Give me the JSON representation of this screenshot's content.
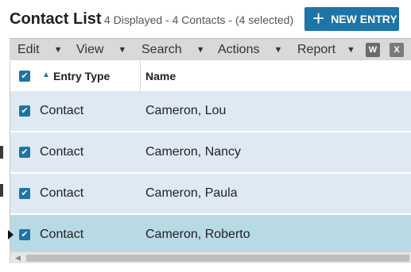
{
  "header": {
    "title": "Contact List",
    "subtitle": "4 Displayed - 4 Contacts - (4 selected)",
    "new_entry_label": "NEW ENTRY",
    "new_entry_icon": "plus-icon"
  },
  "toolbar": {
    "menus": [
      "Edit",
      "View",
      "Search",
      "Actions",
      "Report"
    ],
    "export_word_icon": "word-icon",
    "export_excel_icon": "excel-icon"
  },
  "grid": {
    "columns": [
      "Entry Type",
      "Name"
    ],
    "sorted_column": "Entry Type",
    "all_selected": true,
    "rows": [
      {
        "type": "Contact",
        "name": "Cameron, Lou",
        "selected": true
      },
      {
        "type": "Contact",
        "name": "Cameron, Nancy",
        "selected": true
      },
      {
        "type": "Contact",
        "name": "Cameron, Paula",
        "selected": true
      },
      {
        "type": "Contact",
        "name": "Cameron, Roberto",
        "selected": true,
        "current": true
      }
    ]
  },
  "colors": {
    "accent": "#1c74a7",
    "row_bg": "#dfe9f4",
    "current_row_bg": "#b8dae5",
    "toolbar_bg": "#d9d9d9"
  }
}
